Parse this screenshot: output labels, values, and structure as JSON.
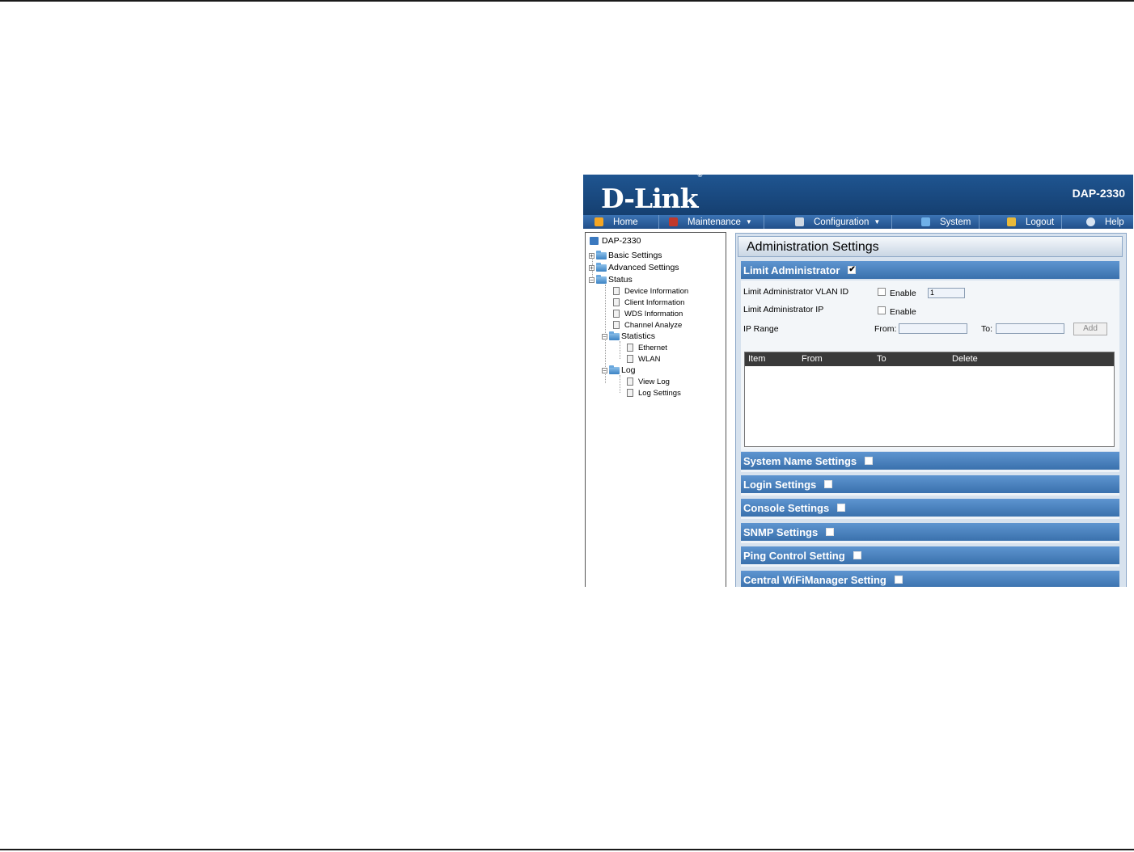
{
  "brand": {
    "logo": "D-Link",
    "registered": "®",
    "model": "DAP-2330"
  },
  "nav": [
    {
      "label": "Home",
      "icon": "home-icon",
      "color": "#f5a623",
      "dropdown": false
    },
    {
      "label": "Maintenance",
      "icon": "tools-icon",
      "color": "#c0392b",
      "dropdown": true
    },
    {
      "label": "Configuration",
      "icon": "disk-icon",
      "color": "#cfd8e3",
      "dropdown": true
    },
    {
      "label": "System",
      "icon": "system-icon",
      "color": "#6fb0e8",
      "dropdown": false
    },
    {
      "label": "Logout",
      "icon": "key-icon",
      "color": "#e8b93a",
      "dropdown": false
    },
    {
      "label": "Help",
      "icon": "help-icon",
      "color": "#d8e4f2",
      "dropdown": false
    }
  ],
  "tree": {
    "root": "DAP-2330",
    "basic": "Basic Settings",
    "advanced": "Advanced Settings",
    "status": "Status",
    "device_info": "Device Information",
    "client_info": "Client Information",
    "wds_info": "WDS Information",
    "channel": "Channel Analyze",
    "statistics": "Statistics",
    "ethernet": "Ethernet",
    "wlan": "WLAN",
    "log": "Log",
    "view_log": "View Log",
    "log_settings": "Log Settings"
  },
  "panel": {
    "title": "Administration Settings",
    "limit_admin": {
      "label": "Limit Administrator",
      "checked": "✔",
      "vlan_label": "Limit Administrator VLAN ID",
      "vlan_enable": "Enable",
      "vlan_value": "1",
      "ip_label": "Limit Administrator IP",
      "ip_enable": "Enable",
      "range_label": "IP Range",
      "from_label": "From:",
      "to_label": "To:",
      "add_label": "Add",
      "columns": [
        "Item",
        "From",
        "To",
        "Delete"
      ]
    },
    "sections": [
      "System Name Settings",
      "Login Settings",
      "Console Settings",
      "SNMP Settings",
      "Ping Control Setting",
      "Central WiFiManager Setting"
    ]
  }
}
